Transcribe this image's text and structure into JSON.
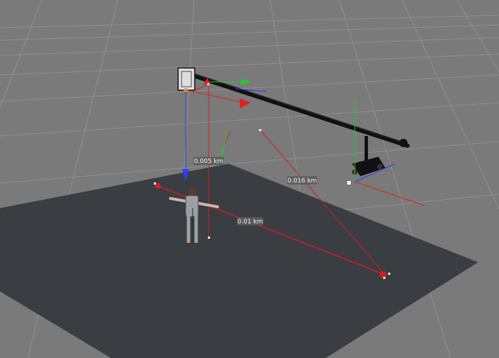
{
  "viewport": {
    "background_color": "#7a7a7a",
    "floor_color": "#3a3d42",
    "grid_color": "#8e8e8e"
  },
  "measurements": {
    "height_label": "0.005 km",
    "crane_distance_label": "0.016 km",
    "floor_distance_label": "0.01 km"
  },
  "objects": {
    "camera_crane": "camera-crane",
    "character": "character-figure",
    "measure_tool": "measure-line"
  },
  "colors": {
    "measure_line": "#d21e1e",
    "axis_x": "#e02020",
    "axis_y": "#28c828",
    "axis_z": "#2a3cff"
  }
}
